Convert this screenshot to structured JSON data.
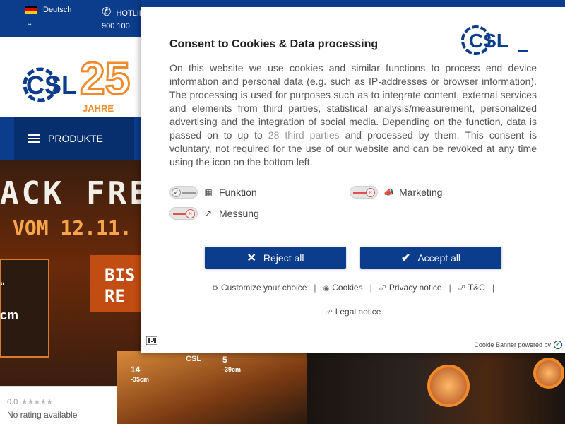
{
  "site": {
    "language": "Deutsch",
    "hotline_label": "HOTLINE",
    "hotline_number": "900 100",
    "logo_text": "CSL",
    "anniversary_number": "25",
    "anniversary_label": "JAHRE",
    "nav_products": "PRODUKTE",
    "banner": {
      "headline": "ACK FRE",
      "date_line": "VOM 12.11.",
      "badge_line1": "BIS",
      "badge_line2": "RE",
      "quote": "“",
      "size_label": "cm",
      "laptop_tag_1": "14",
      "laptop_sub_1": "-35cm",
      "laptop_logo": "CSL",
      "laptop_tag_2": "5",
      "laptop_sub_2": "-39cm"
    },
    "rating": {
      "score": "0.0",
      "stars": "★★★★★",
      "text": "No rating available"
    }
  },
  "consent": {
    "title": "Consent to Cookies & Data processing",
    "logo_text": "CSL",
    "body_part1": "On this website we use cookies and similar functions to process end device information and personal data (e.g. such as IP-addresses or browser information). The processing is used for purposes such as to integrate content, external services and elements from third parties, statistical analysis/measurement, personalized advertising and the integration of social media. Depending on the function, data is passed on to up to ",
    "body_link": "28 third parties",
    "body_part2": " and processed by them. This consent is voluntary, not required for the use of our website and can be revoked at any time using the icon on the bottom left.",
    "toggles": {
      "funktion": "Funktion",
      "marketing": "Marketing",
      "messung": "Messung"
    },
    "reject_label": "Reject all",
    "accept_label": "Accept all",
    "links": {
      "customize": "Customize your choice",
      "cookies": "Cookies",
      "privacy": "Privacy notice",
      "tc": "T&C",
      "legal": "Legal notice"
    },
    "separator": "|",
    "powered_by": "Cookie Banner powered by"
  },
  "colors": {
    "brand_blue": "#0b3d8c",
    "accent_orange": "#f08a2a",
    "toggle_off_red": "#e05050"
  }
}
